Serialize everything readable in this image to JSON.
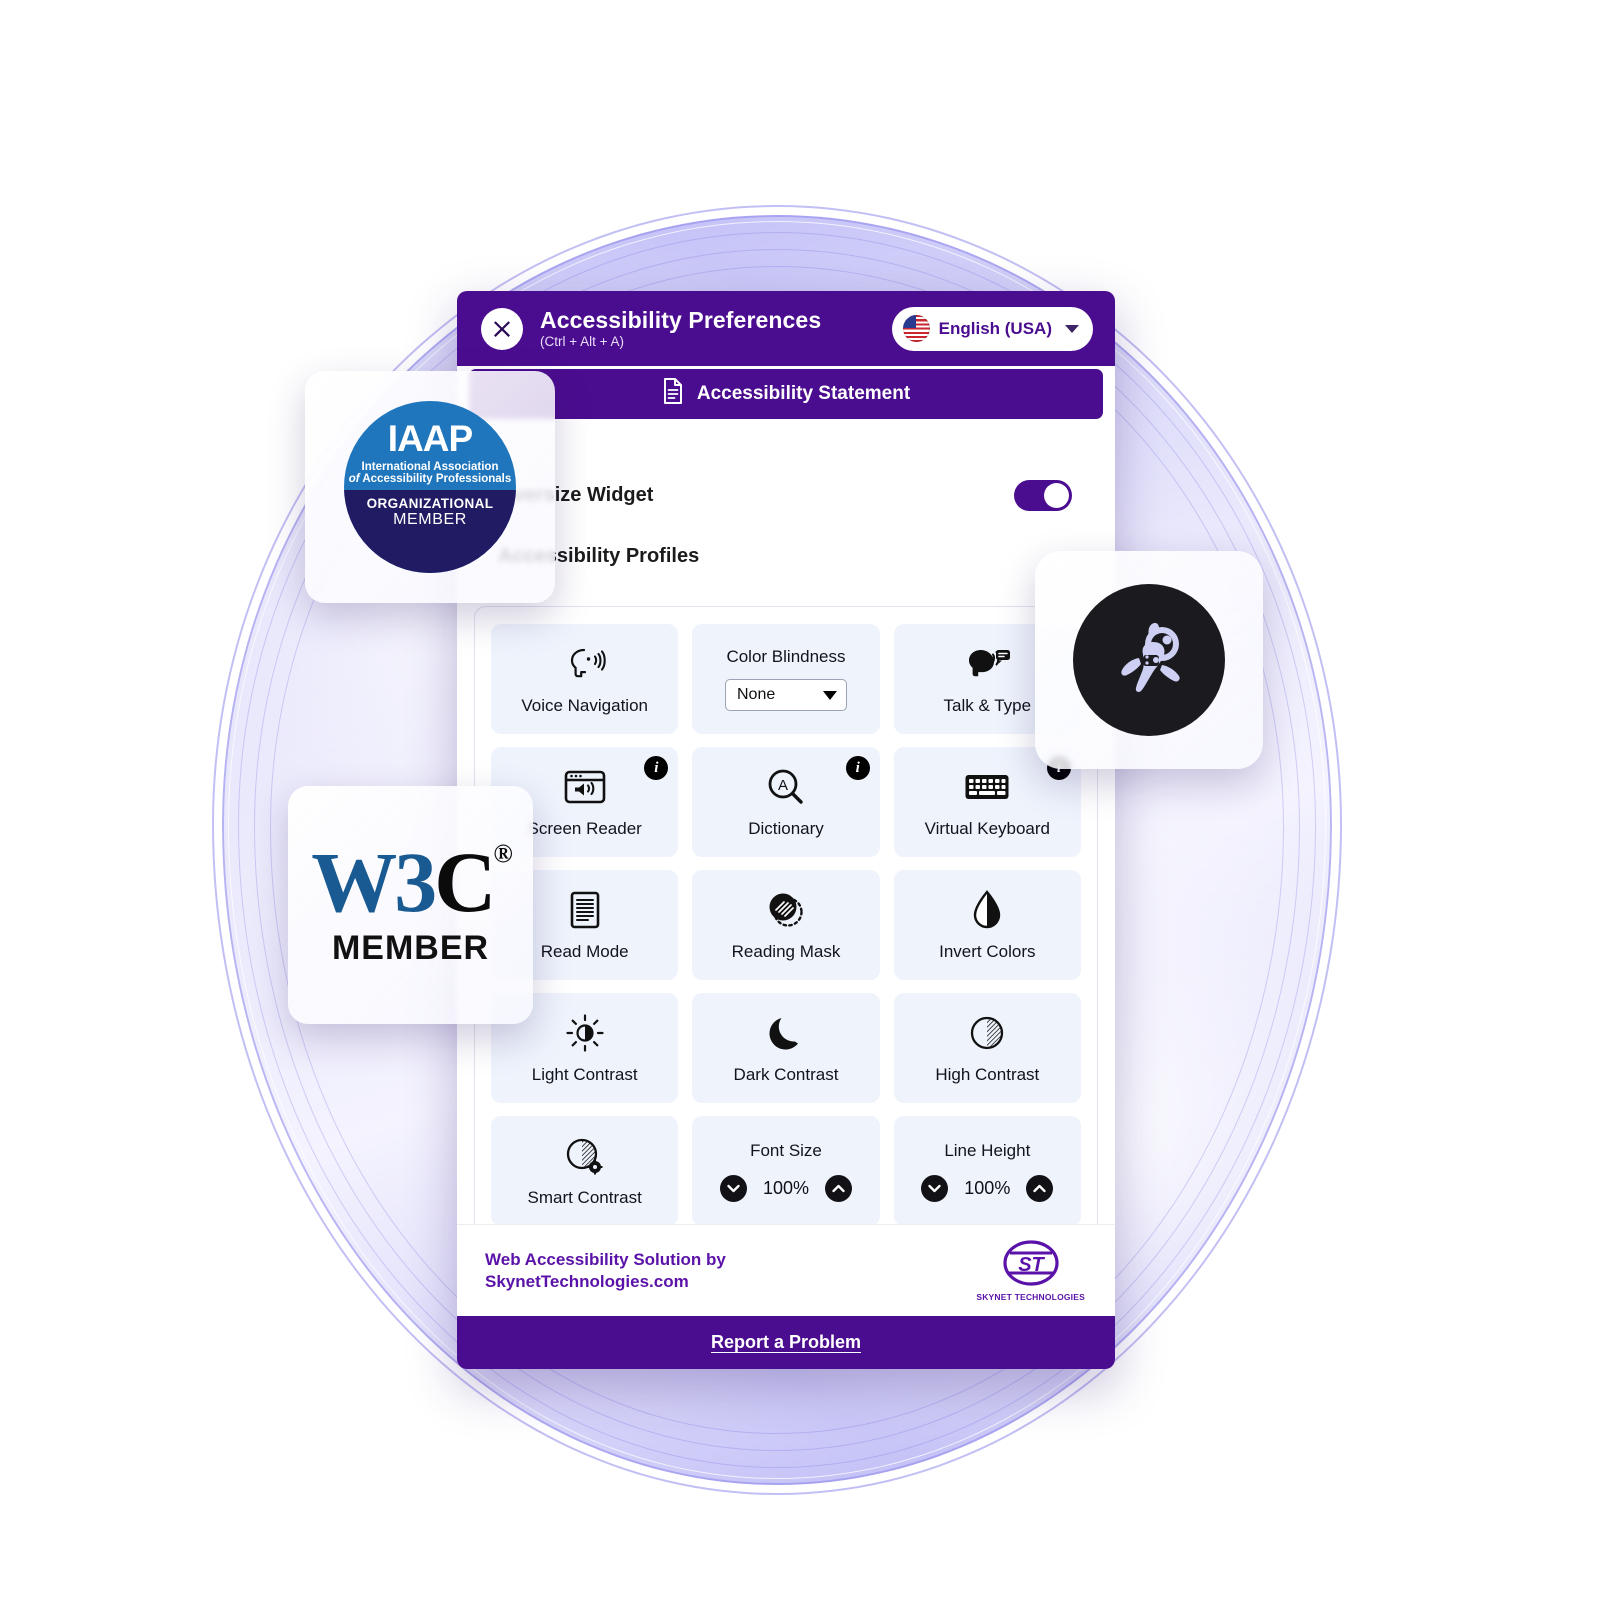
{
  "header": {
    "title": "Accessibility Preferences",
    "shortcut": "(Ctrl + Alt + A)",
    "close_icon": "close-x-icon",
    "language": "English (USA)",
    "language_flag": "usa-flag-icon",
    "chevron_icon": "chevron-down-icon"
  },
  "statement": {
    "label": "Accessibility Statement",
    "icon": "document-icon"
  },
  "settings": {
    "oversize_widget_label": "Oversize Widget",
    "oversize_widget_on": true,
    "profiles_label": "Accessibility Profiles"
  },
  "features": [
    {
      "label": "Voice Navigation",
      "icon": "voice-navigation-icon",
      "type": "toggle",
      "info": false
    },
    {
      "label": "Color Blindness",
      "icon": "",
      "type": "select",
      "value": "None",
      "info": false
    },
    {
      "label": "Talk & Type",
      "icon": "talk-and-type-icon",
      "type": "toggle",
      "info": false
    },
    {
      "label": "Screen Reader",
      "icon": "screen-reader-icon",
      "type": "toggle",
      "info": true
    },
    {
      "label": "Dictionary",
      "icon": "dictionary-icon",
      "type": "toggle",
      "info": true
    },
    {
      "label": "Virtual Keyboard",
      "icon": "virtual-keyboard-icon",
      "type": "toggle",
      "info": true
    },
    {
      "label": "Read Mode",
      "icon": "read-mode-icon",
      "type": "toggle",
      "info": false
    },
    {
      "label": "Reading Mask",
      "icon": "reading-mask-icon",
      "type": "toggle",
      "info": false
    },
    {
      "label": "Invert Colors",
      "icon": "invert-colors-icon",
      "type": "toggle",
      "info": false
    },
    {
      "label": "Light Contrast",
      "icon": "light-contrast-icon",
      "type": "toggle",
      "info": false
    },
    {
      "label": "Dark Contrast",
      "icon": "dark-contrast-icon",
      "type": "toggle",
      "info": false
    },
    {
      "label": "High Contrast",
      "icon": "high-contrast-icon",
      "type": "toggle",
      "info": false
    },
    {
      "label": "Smart Contrast",
      "icon": "smart-contrast-icon",
      "type": "toggle",
      "info": false
    },
    {
      "label": "Font Size",
      "icon": "",
      "type": "stepper",
      "value": "100%",
      "info": false
    },
    {
      "label": "Line Height",
      "icon": "",
      "type": "stepper",
      "value": "100%",
      "info": false
    }
  ],
  "footer": {
    "line1": "Web Accessibility Solution by",
    "line2": "SkynetTechnologies.com",
    "logo_mark": "ST",
    "logo_name": "SKYNET TECHNOLOGIES",
    "report_label": "Report a Problem"
  },
  "badges": {
    "iaap": {
      "word": "IAAP",
      "line1": "International Association",
      "line2_italic": "of",
      "line2": "Accessibility Professionals",
      "org": "ORGANIZATIONAL",
      "member": "MEMBER"
    },
    "w3c": {
      "mark_w3": "W3",
      "mark_c": "C",
      "registered": "®",
      "member": "MEMBER"
    },
    "astronaut": {
      "icon": "astronaut-icon"
    }
  },
  "colors": {
    "brand_purple": "#4b0d8f",
    "tile_bg": "#eef3fc",
    "footer_purple": "#5a12a8",
    "iaap_blue": "#1f76bc",
    "iaap_navy": "#211b63",
    "w3c_blue": "#1a5a92"
  }
}
